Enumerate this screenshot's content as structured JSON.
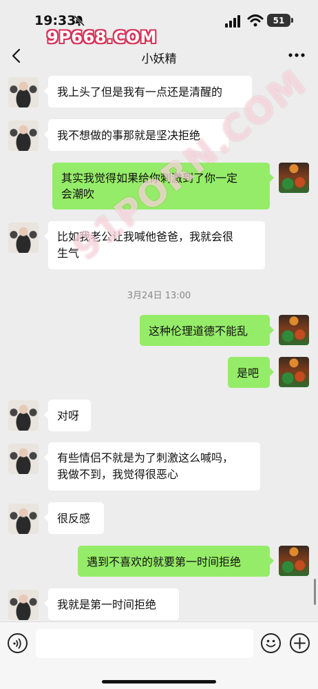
{
  "status_bar": {
    "time": "19:33",
    "battery": "51"
  },
  "watermarks": {
    "top": "9P668.COM",
    "diagonal": "91PORN.COM"
  },
  "nav": {
    "title": "小妖精"
  },
  "messages": [
    {
      "side": "in",
      "text": "我上头了但是我有一点还是清醒的"
    },
    {
      "side": "in",
      "text": "我不想做的事那就是坚决拒绝"
    },
    {
      "side": "out",
      "line1": "其实我觉得如果给你刺激到了你一定",
      "line2": "会潮吹"
    },
    {
      "side": "in",
      "line1": "比如我老公让我喊他爸爸，我就会很",
      "line2": "生气"
    },
    {
      "side": "out",
      "text": "这种伦理道德不能乱"
    },
    {
      "side": "out",
      "text": "是吧"
    },
    {
      "side": "in",
      "text": "对呀"
    },
    {
      "side": "in",
      "line1": "有些情侣不就是为了刺激这么喊吗，",
      "line2": "我做不到，我觉得很恶心"
    },
    {
      "side": "in",
      "text": "很反感"
    },
    {
      "side": "out",
      "text": "遇到不喜欢的就要第一时间拒绝"
    },
    {
      "side": "in",
      "text": "我就是第一时间拒绝"
    }
  ],
  "timestamp": "3月24日 13:00",
  "input": {
    "placeholder": ""
  }
}
